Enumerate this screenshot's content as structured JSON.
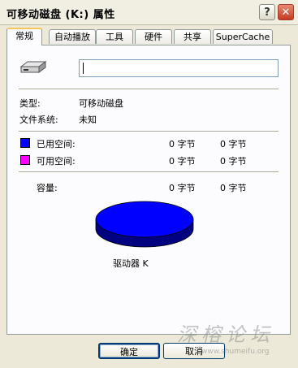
{
  "window": {
    "title": "可移动磁盘 (K:) 属性",
    "help_glyph": "?",
    "close_glyph": "✕"
  },
  "tabs": [
    {
      "label": "常规",
      "active": true
    },
    {
      "label": "自动播放",
      "active": false
    },
    {
      "label": "工具",
      "active": false
    },
    {
      "label": "硬件",
      "active": false
    },
    {
      "label": "共享",
      "active": false
    },
    {
      "label": "SuperCache",
      "active": false
    }
  ],
  "general": {
    "volume_name_value": "",
    "type_label": "类型:",
    "type_value": "可移动磁盘",
    "fs_label": "文件系统:",
    "fs_value": "未知",
    "used_label": "已用空间:",
    "used_bytes": "0 字节",
    "used_size": "0 字节",
    "free_label": "可用空间:",
    "free_bytes": "0 字节",
    "free_size": "0 字节",
    "capacity_label": "容量:",
    "capacity_bytes": "0 字节",
    "capacity_size": "0 字节",
    "drive_label": "驱动器 K"
  },
  "colors": {
    "used": "#0000ff",
    "free": "#ff00ff",
    "pie": "#0000ff"
  },
  "buttons": {
    "ok": "确定",
    "cancel": "取消"
  },
  "watermark": {
    "text": "深榕论坛",
    "url": "www.shumeifu.org"
  }
}
